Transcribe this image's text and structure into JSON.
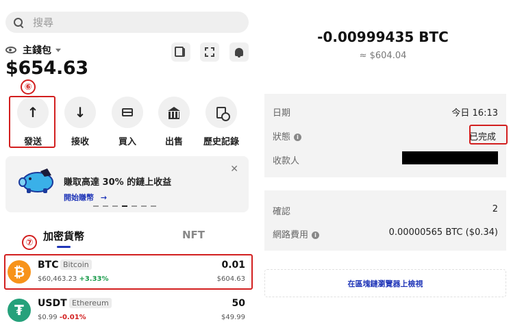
{
  "search": {
    "placeholder": "搜尋"
  },
  "wallet": {
    "name": "主錢包",
    "balance": "$654.63"
  },
  "markers": {
    "six": "⑥",
    "seven": "⑦"
  },
  "actions": [
    {
      "label": "發送",
      "icon": "arrow-up-icon"
    },
    {
      "label": "接收",
      "icon": "arrow-down-icon"
    },
    {
      "label": "買入",
      "icon": "card-icon"
    },
    {
      "label": "出售",
      "icon": "bank-icon"
    },
    {
      "label": "歷史記錄",
      "icon": "history-icon"
    }
  ],
  "promo": {
    "text": "賺取高達 30% 的鏈上收益",
    "link": "開始賺幣",
    "link_arrow": "→",
    "close": "✕"
  },
  "tabs": [
    {
      "label": "加密貨幣"
    },
    {
      "label": "NFT"
    }
  ],
  "assets": [
    {
      "symbol": "BTC",
      "network": "Bitcoin",
      "price": "$60,463.23",
      "change": "+3.33%",
      "amount": "0.01",
      "value": "$604.63",
      "icon_char": "₿",
      "icon_color": "#f7931a",
      "change_color": "#1a9b4b"
    },
    {
      "symbol": "USDT",
      "network": "Ethereum",
      "price": "$0.99",
      "change": "-0.01%",
      "amount": "50",
      "value": "$49.99",
      "icon_char": "₮",
      "icon_color": "#26a17b",
      "change_color": "#d21e1e"
    }
  ],
  "tx": {
    "amount": "-0.00999435 BTC",
    "fiat": "≈ $604.04",
    "date_label": "日期",
    "date_value": "今日 16:13",
    "status_label": "狀態",
    "status_value": "已完成",
    "recipient_label": "收款人",
    "confirm_label": "確認",
    "confirm_value": "2",
    "fee_label": "網路費用",
    "fee_value": "0.00000565 BTC ($0.34)",
    "explorer_link": "在區塊鏈瀏覽器上檢視"
  },
  "colors": {
    "accent": "#2036b8",
    "highlight": "#d21e1e"
  }
}
